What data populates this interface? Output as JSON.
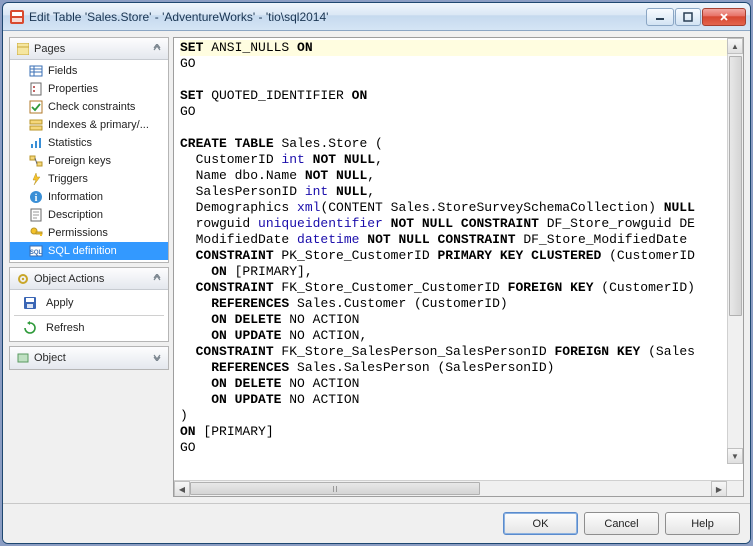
{
  "title": "Edit Table 'Sales.Store' - 'AdventureWorks' - 'tio\\sql2014'",
  "panels": {
    "pages": {
      "title": "Pages",
      "items": [
        {
          "label": "Fields"
        },
        {
          "label": "Properties"
        },
        {
          "label": "Check constraints"
        },
        {
          "label": "Indexes & primary/..."
        },
        {
          "label": "Statistics"
        },
        {
          "label": "Foreign keys"
        },
        {
          "label": "Triggers"
        },
        {
          "label": "Information"
        },
        {
          "label": "Description"
        },
        {
          "label": "Permissions"
        },
        {
          "label": "SQL definition",
          "selected": true
        }
      ]
    },
    "object_actions": {
      "title": "Object Actions",
      "items": [
        {
          "label": "Apply"
        },
        {
          "label": "Refresh"
        }
      ]
    },
    "object": {
      "title": "Object"
    }
  },
  "buttons": {
    "ok": "OK",
    "cancel": "Cancel",
    "help": "Help"
  },
  "sql_lines": [
    [
      {
        "t": "SET",
        "c": "kw"
      },
      {
        "t": " ANSI_NULLS "
      },
      {
        "t": "ON",
        "c": "kw"
      }
    ],
    [
      {
        "t": "GO"
      }
    ],
    [],
    [
      {
        "t": "SET",
        "c": "kw"
      },
      {
        "t": " QUOTED_IDENTIFIER "
      },
      {
        "t": "ON",
        "c": "kw"
      }
    ],
    [
      {
        "t": "GO"
      }
    ],
    [],
    [
      {
        "t": "CREATE",
        "c": "kw"
      },
      {
        "t": " "
      },
      {
        "t": "TABLE",
        "c": "kw"
      },
      {
        "t": " Sales.Store ("
      }
    ],
    [
      {
        "t": "  CustomerID "
      },
      {
        "t": "int",
        "c": "ty"
      },
      {
        "t": " "
      },
      {
        "t": "NOT",
        "c": "kw"
      },
      {
        "t": " "
      },
      {
        "t": "NULL",
        "c": "kw"
      },
      {
        "t": ","
      }
    ],
    [
      {
        "t": "  Name dbo.Name "
      },
      {
        "t": "NOT",
        "c": "kw"
      },
      {
        "t": " "
      },
      {
        "t": "NULL",
        "c": "kw"
      },
      {
        "t": ","
      }
    ],
    [
      {
        "t": "  SalesPersonID "
      },
      {
        "t": "int",
        "c": "ty"
      },
      {
        "t": " "
      },
      {
        "t": "NULL",
        "c": "kw"
      },
      {
        "t": ","
      }
    ],
    [
      {
        "t": "  Demographics "
      },
      {
        "t": "xml",
        "c": "ty"
      },
      {
        "t": "(CONTENT Sales.StoreSurveySchemaCollection) "
      },
      {
        "t": "NULL",
        "c": "kw"
      }
    ],
    [
      {
        "t": "  rowguid "
      },
      {
        "t": "uniqueidentifier",
        "c": "ty"
      },
      {
        "t": " "
      },
      {
        "t": "NOT",
        "c": "kw"
      },
      {
        "t": " "
      },
      {
        "t": "NULL",
        "c": "kw"
      },
      {
        "t": " "
      },
      {
        "t": "CONSTRAINT",
        "c": "kw"
      },
      {
        "t": " DF_Store_rowguid DE"
      }
    ],
    [
      {
        "t": "  ModifiedDate "
      },
      {
        "t": "datetime",
        "c": "ty"
      },
      {
        "t": " "
      },
      {
        "t": "NOT",
        "c": "kw"
      },
      {
        "t": " "
      },
      {
        "t": "NULL",
        "c": "kw"
      },
      {
        "t": " "
      },
      {
        "t": "CONSTRAINT",
        "c": "kw"
      },
      {
        "t": " DF_Store_ModifiedDate"
      }
    ],
    [
      {
        "t": "  "
      },
      {
        "t": "CONSTRAINT",
        "c": "kw"
      },
      {
        "t": " PK_Store_CustomerID "
      },
      {
        "t": "PRIMARY",
        "c": "kw"
      },
      {
        "t": " "
      },
      {
        "t": "KEY",
        "c": "kw"
      },
      {
        "t": " "
      },
      {
        "t": "CLUSTERED",
        "c": "kw"
      },
      {
        "t": " (CustomerID"
      }
    ],
    [
      {
        "t": "    "
      },
      {
        "t": "ON",
        "c": "kw"
      },
      {
        "t": " [PRIMARY],"
      }
    ],
    [
      {
        "t": "  "
      },
      {
        "t": "CONSTRAINT",
        "c": "kw"
      },
      {
        "t": " FK_Store_Customer_CustomerID "
      },
      {
        "t": "FOREIGN",
        "c": "kw"
      },
      {
        "t": " "
      },
      {
        "t": "KEY",
        "c": "kw"
      },
      {
        "t": " (CustomerID)"
      }
    ],
    [
      {
        "t": "    "
      },
      {
        "t": "REFERENCES",
        "c": "kw"
      },
      {
        "t": " Sales.Customer (CustomerID)"
      }
    ],
    [
      {
        "t": "    "
      },
      {
        "t": "ON",
        "c": "kw"
      },
      {
        "t": " "
      },
      {
        "t": "DELETE",
        "c": "kw"
      },
      {
        "t": " NO ACTION"
      }
    ],
    [
      {
        "t": "    "
      },
      {
        "t": "ON",
        "c": "kw"
      },
      {
        "t": " "
      },
      {
        "t": "UPDATE",
        "c": "kw"
      },
      {
        "t": " NO ACTION,"
      }
    ],
    [
      {
        "t": "  "
      },
      {
        "t": "CONSTRAINT",
        "c": "kw"
      },
      {
        "t": " FK_Store_SalesPerson_SalesPersonID "
      },
      {
        "t": "FOREIGN",
        "c": "kw"
      },
      {
        "t": " "
      },
      {
        "t": "KEY",
        "c": "kw"
      },
      {
        "t": " (Sales"
      }
    ],
    [
      {
        "t": "    "
      },
      {
        "t": "REFERENCES",
        "c": "kw"
      },
      {
        "t": " Sales.SalesPerson (SalesPersonID)"
      }
    ],
    [
      {
        "t": "    "
      },
      {
        "t": "ON",
        "c": "kw"
      },
      {
        "t": " "
      },
      {
        "t": "DELETE",
        "c": "kw"
      },
      {
        "t": " NO ACTION"
      }
    ],
    [
      {
        "t": "    "
      },
      {
        "t": "ON",
        "c": "kw"
      },
      {
        "t": " "
      },
      {
        "t": "UPDATE",
        "c": "kw"
      },
      {
        "t": " NO ACTION"
      }
    ],
    [
      {
        "t": ")"
      }
    ],
    [
      {
        "t": "ON",
        "c": "kw"
      },
      {
        "t": " [PRIMARY]"
      }
    ],
    [
      {
        "t": "GO"
      }
    ]
  ]
}
